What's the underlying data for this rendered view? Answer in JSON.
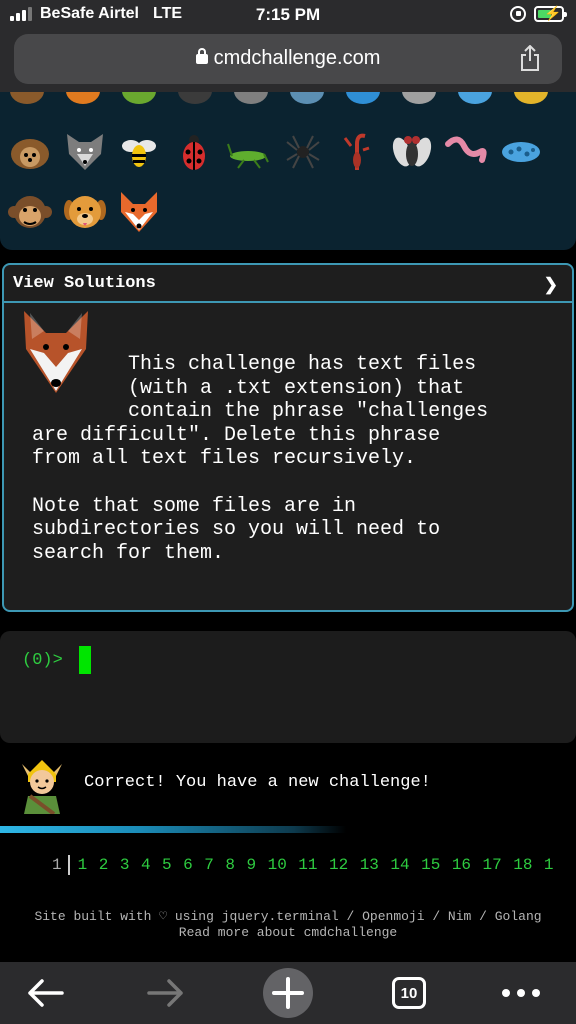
{
  "status_bar": {
    "carrier": "BeSafe Airtel",
    "network": "LTE",
    "time": "7:15 PM",
    "battery_color": "#4cd964"
  },
  "browser": {
    "url": "cmdchallenge.com",
    "tab_count": "10",
    "icons": {
      "lock": "lock-icon",
      "share": "share-icon",
      "back": "back-arrow-icon",
      "forward": "forward-arrow-icon",
      "new_tab": "plus-icon",
      "more": "more-dots-icon"
    }
  },
  "emoji_panel": {
    "row1": [
      "hedgehog",
      "wolf",
      "bee",
      "ladybug",
      "cricket",
      "spider",
      "scorpion",
      "fly",
      "worm",
      "microbe"
    ],
    "row2": [
      "monkey",
      "dog",
      "fox"
    ]
  },
  "solution_card": {
    "title": "View Solutions",
    "chevron": "❯",
    "text": "        This challenge has text files\n        (with a .txt extension) that\n        contain the phrase \"challenges\nare difficult\". Delete this phrase\nfrom all text files recursively.\n\nNote that some files are in\nsubdirectories so you will need to\nsearch for them.",
    "accent_color": "#3d98b4"
  },
  "terminal": {
    "prompt": "(0)>",
    "cursor_color": "#00e500"
  },
  "message": {
    "text": "Correct! You have a new challenge!"
  },
  "pagination": {
    "current": "1",
    "pages": [
      "1",
      "2",
      "3",
      "4",
      "5",
      "6",
      "7",
      "8",
      "9",
      "10",
      "11",
      "12",
      "13",
      "14",
      "15",
      "16",
      "17",
      "18",
      "1"
    ]
  },
  "footer": {
    "line1": "Site built with ♡ using jquery.terminal / Openmoji / Nim / Golang",
    "line2": "Read more about cmdchallenge"
  }
}
